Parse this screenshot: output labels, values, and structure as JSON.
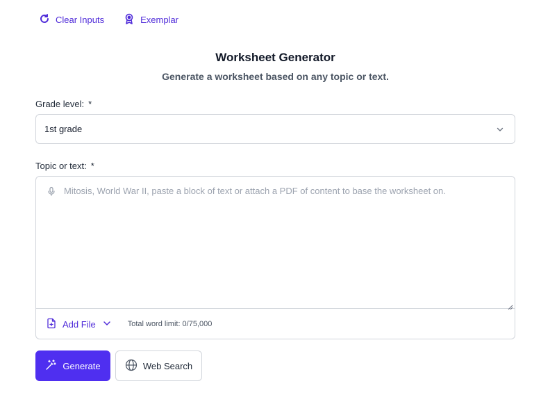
{
  "top_links": {
    "clear_inputs": "Clear Inputs",
    "exemplar": "Exemplar"
  },
  "header": {
    "title": "Worksheet Generator",
    "subtitle": "Generate a worksheet based on any topic or text."
  },
  "grade_level": {
    "label": "Grade level:",
    "required_mark": "*",
    "selected_value": "1st grade"
  },
  "topic": {
    "label": "Topic or text:",
    "required_mark": "*",
    "placeholder": "Mitosis, World War II, paste a block of text or attach a PDF of content to base the worksheet on.",
    "add_file_label": "Add File",
    "word_limit": "Total word limit: 0/75,000"
  },
  "actions": {
    "generate_label": "Generate",
    "web_search_label": "Web Search"
  },
  "colors": {
    "accent": "#4f2bd9",
    "primary_button": "#4f2ff0",
    "border": "#d1d5db",
    "placeholder": "#9ca3af"
  },
  "icons": {
    "clear": "refresh-icon",
    "exemplar": "award-ribbon-icon",
    "grade_select": "chevron-down-icon",
    "mic": "microphone-icon",
    "add_file": "file-plus-icon",
    "add_file_menu": "chevron-down-icon",
    "generate": "magic-wand-icon",
    "web_search": "globe-icon"
  }
}
